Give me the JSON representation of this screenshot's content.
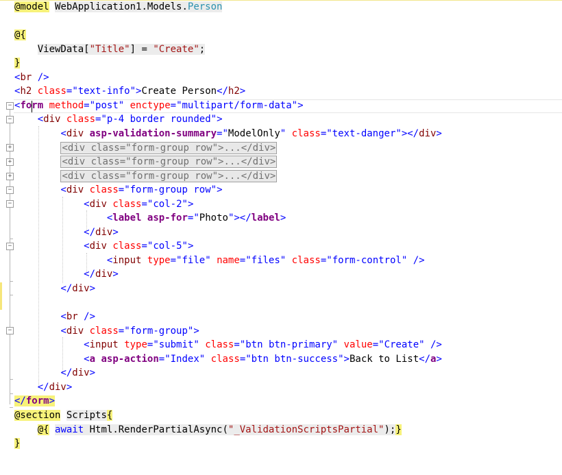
{
  "editor": {
    "colors": {
      "razor_highlight": "#f7f27a",
      "tag": "#0000ff",
      "element": "#800000",
      "attribute": "#ff0000",
      "value": "#0000ff",
      "tag_helper": "#800080"
    },
    "lines": [
      {
        "tokens": [
          {
            "t": "@model",
            "c": "hl"
          },
          {
            "t": " "
          },
          {
            "t": "WebApplication1.Models.",
            "c": "dim"
          },
          {
            "t": "Person",
            "c": "teal dim"
          }
        ]
      },
      {
        "tokens": []
      },
      {
        "tokens": [
          {
            "t": "@{",
            "c": "hl"
          }
        ]
      },
      {
        "tokens": [
          {
            "t": "    "
          },
          {
            "t": "ViewData[",
            "c": "dim"
          },
          {
            "t": "\"Title\"",
            "c": "str dim"
          },
          {
            "t": "] = ",
            "c": "dim"
          },
          {
            "t": "\"Create\"",
            "c": "str dim"
          },
          {
            "t": ";",
            "c": "dim"
          }
        ]
      },
      {
        "tokens": [
          {
            "t": "}",
            "c": "hl"
          }
        ]
      },
      {
        "tokens": [
          {
            "t": "<",
            "c": "blue"
          },
          {
            "t": "br",
            "c": "maroon"
          },
          {
            "t": " />",
            "c": "blue"
          }
        ]
      },
      {
        "tokens": [
          {
            "t": "<",
            "c": "blue"
          },
          {
            "t": "h2",
            "c": "maroon"
          },
          {
            "t": " "
          },
          {
            "t": "class",
            "c": "red"
          },
          {
            "t": "=",
            "c": "blue"
          },
          {
            "t": "\"text-info\"",
            "c": "blue"
          },
          {
            "t": ">",
            "c": "blue"
          },
          {
            "t": "Create Person"
          },
          {
            "t": "</",
            "c": "blue"
          },
          {
            "t": "h2",
            "c": "maroon"
          },
          {
            "t": ">",
            "c": "blue"
          }
        ]
      },
      {
        "tokens": [
          {
            "t": "<",
            "c": "blue"
          },
          {
            "t": "form",
            "c": "purple bold"
          },
          {
            "t": " "
          },
          {
            "t": "method",
            "c": "red"
          },
          {
            "t": "=",
            "c": "blue"
          },
          {
            "t": "\"post\"",
            "c": "blue"
          },
          {
            "t": " "
          },
          {
            "t": "enctype",
            "c": "red"
          },
          {
            "t": "=",
            "c": "blue"
          },
          {
            "t": "\"multipart/form-data\"",
            "c": "blue"
          },
          {
            "t": ">",
            "c": "blue"
          }
        ]
      },
      {
        "tokens": [
          {
            "t": "    "
          },
          {
            "t": "<",
            "c": "blue"
          },
          {
            "t": "div",
            "c": "maroon"
          },
          {
            "t": " "
          },
          {
            "t": "class",
            "c": "red"
          },
          {
            "t": "=",
            "c": "blue"
          },
          {
            "t": "\"p-4 border rounded\"",
            "c": "blue"
          },
          {
            "t": ">",
            "c": "blue"
          }
        ]
      },
      {
        "tokens": [
          {
            "t": "        "
          },
          {
            "t": "<",
            "c": "blue"
          },
          {
            "t": "div",
            "c": "maroon"
          },
          {
            "t": " "
          },
          {
            "t": "asp-validation-summary",
            "c": "purple bold"
          },
          {
            "t": "=",
            "c": "blue"
          },
          {
            "t": "\"",
            "c": "blue"
          },
          {
            "t": "ModelOnly"
          },
          {
            "t": "\"",
            "c": "blue"
          },
          {
            "t": " "
          },
          {
            "t": "class",
            "c": "red"
          },
          {
            "t": "=",
            "c": "blue"
          },
          {
            "t": "\"text-danger\"",
            "c": "blue"
          },
          {
            "t": "></",
            "c": "blue"
          },
          {
            "t": "div",
            "c": "maroon"
          },
          {
            "t": ">",
            "c": "blue"
          }
        ]
      },
      {
        "tokens": [
          {
            "t": "        "
          },
          {
            "t": "<div class=\"form-group row\">...</div>",
            "c": "collapsed"
          }
        ]
      },
      {
        "tokens": [
          {
            "t": "        "
          },
          {
            "t": "<div class=\"form-group row\">...</div>",
            "c": "collapsed"
          }
        ]
      },
      {
        "tokens": [
          {
            "t": "        "
          },
          {
            "t": "<div class=\"form-group row\">...</div>",
            "c": "collapsed"
          }
        ]
      },
      {
        "tokens": [
          {
            "t": "        "
          },
          {
            "t": "<",
            "c": "blue"
          },
          {
            "t": "div",
            "c": "maroon"
          },
          {
            "t": " "
          },
          {
            "t": "class",
            "c": "red"
          },
          {
            "t": "=",
            "c": "blue"
          },
          {
            "t": "\"form-group row\"",
            "c": "blue"
          },
          {
            "t": ">",
            "c": "blue"
          }
        ]
      },
      {
        "tokens": [
          {
            "t": "            "
          },
          {
            "t": "<",
            "c": "blue"
          },
          {
            "t": "div",
            "c": "maroon"
          },
          {
            "t": " "
          },
          {
            "t": "class",
            "c": "red"
          },
          {
            "t": "=",
            "c": "blue"
          },
          {
            "t": "\"col-2\"",
            "c": "blue"
          },
          {
            "t": ">",
            "c": "blue"
          }
        ]
      },
      {
        "tokens": [
          {
            "t": "                "
          },
          {
            "t": "<",
            "c": "blue"
          },
          {
            "t": "label",
            "c": "purple bold"
          },
          {
            "t": " "
          },
          {
            "t": "asp-for",
            "c": "purple bold"
          },
          {
            "t": "=",
            "c": "blue"
          },
          {
            "t": "\"",
            "c": "blue"
          },
          {
            "t": "Photo"
          },
          {
            "t": "\"",
            "c": "blue"
          },
          {
            "t": "></",
            "c": "blue"
          },
          {
            "t": "label",
            "c": "purple bold"
          },
          {
            "t": ">",
            "c": "blue"
          }
        ]
      },
      {
        "tokens": [
          {
            "t": "            "
          },
          {
            "t": "</",
            "c": "blue"
          },
          {
            "t": "div",
            "c": "maroon"
          },
          {
            "t": ">",
            "c": "blue"
          }
        ]
      },
      {
        "tokens": [
          {
            "t": "            "
          },
          {
            "t": "<",
            "c": "blue"
          },
          {
            "t": "div",
            "c": "maroon"
          },
          {
            "t": " "
          },
          {
            "t": "class",
            "c": "red"
          },
          {
            "t": "=",
            "c": "blue"
          },
          {
            "t": "\"col-5\"",
            "c": "blue"
          },
          {
            "t": ">",
            "c": "blue"
          }
        ]
      },
      {
        "tokens": [
          {
            "t": "                "
          },
          {
            "t": "<",
            "c": "blue"
          },
          {
            "t": "input",
            "c": "maroon"
          },
          {
            "t": " "
          },
          {
            "t": "type",
            "c": "red"
          },
          {
            "t": "=",
            "c": "blue"
          },
          {
            "t": "\"file\"",
            "c": "blue"
          },
          {
            "t": " "
          },
          {
            "t": "name",
            "c": "red"
          },
          {
            "t": "=",
            "c": "blue"
          },
          {
            "t": "\"files\"",
            "c": "blue"
          },
          {
            "t": " "
          },
          {
            "t": "class",
            "c": "red"
          },
          {
            "t": "=",
            "c": "blue"
          },
          {
            "t": "\"form-control\"",
            "c": "blue"
          },
          {
            "t": " />",
            "c": "blue"
          }
        ]
      },
      {
        "tokens": [
          {
            "t": "            "
          },
          {
            "t": "</",
            "c": "blue"
          },
          {
            "t": "div",
            "c": "maroon"
          },
          {
            "t": ">",
            "c": "blue"
          }
        ]
      },
      {
        "tokens": [
          {
            "t": "        "
          },
          {
            "t": "</",
            "c": "blue"
          },
          {
            "t": "div",
            "c": "maroon"
          },
          {
            "t": ">",
            "c": "blue"
          }
        ]
      },
      {
        "tokens": []
      },
      {
        "tokens": [
          {
            "t": "        "
          },
          {
            "t": "<",
            "c": "blue"
          },
          {
            "t": "br",
            "c": "maroon"
          },
          {
            "t": " />",
            "c": "blue"
          }
        ]
      },
      {
        "tokens": [
          {
            "t": "        "
          },
          {
            "t": "<",
            "c": "blue"
          },
          {
            "t": "div",
            "c": "maroon"
          },
          {
            "t": " "
          },
          {
            "t": "class",
            "c": "red"
          },
          {
            "t": "=",
            "c": "blue"
          },
          {
            "t": "\"form-group\"",
            "c": "blue"
          },
          {
            "t": ">",
            "c": "blue"
          }
        ]
      },
      {
        "tokens": [
          {
            "t": "            "
          },
          {
            "t": "<",
            "c": "blue"
          },
          {
            "t": "input",
            "c": "maroon"
          },
          {
            "t": " "
          },
          {
            "t": "type",
            "c": "red"
          },
          {
            "t": "=",
            "c": "blue"
          },
          {
            "t": "\"submit\"",
            "c": "blue"
          },
          {
            "t": " "
          },
          {
            "t": "class",
            "c": "red"
          },
          {
            "t": "=",
            "c": "blue"
          },
          {
            "t": "\"btn btn-primary\"",
            "c": "blue"
          },
          {
            "t": " "
          },
          {
            "t": "value",
            "c": "red"
          },
          {
            "t": "=",
            "c": "blue"
          },
          {
            "t": "\"Create\"",
            "c": "blue"
          },
          {
            "t": " />",
            "c": "blue"
          }
        ]
      },
      {
        "tokens": [
          {
            "t": "            "
          },
          {
            "t": "<",
            "c": "blue"
          },
          {
            "t": "a",
            "c": "purple bold"
          },
          {
            "t": " "
          },
          {
            "t": "asp-action",
            "c": "purple bold"
          },
          {
            "t": "=",
            "c": "blue"
          },
          {
            "t": "\"Index\"",
            "c": "blue"
          },
          {
            "t": " "
          },
          {
            "t": "class",
            "c": "red"
          },
          {
            "t": "=",
            "c": "blue"
          },
          {
            "t": "\"btn btn-success\"",
            "c": "blue"
          },
          {
            "t": ">",
            "c": "blue"
          },
          {
            "t": "Back to List"
          },
          {
            "t": "</",
            "c": "blue"
          },
          {
            "t": "a",
            "c": "purple bold"
          },
          {
            "t": ">",
            "c": "blue"
          }
        ]
      },
      {
        "tokens": [
          {
            "t": "        "
          },
          {
            "t": "</",
            "c": "blue"
          },
          {
            "t": "div",
            "c": "maroon"
          },
          {
            "t": ">",
            "c": "blue"
          }
        ]
      },
      {
        "tokens": [
          {
            "t": "    "
          },
          {
            "t": "</",
            "c": "blue"
          },
          {
            "t": "div",
            "c": "maroon"
          },
          {
            "t": ">",
            "c": "blue"
          }
        ]
      },
      {
        "tokens": [
          {
            "t": "</",
            "c": "blue hl"
          },
          {
            "t": "form",
            "c": "purple bold hl"
          },
          {
            "t": ">",
            "c": "blue hl"
          }
        ]
      },
      {
        "tokens": [
          {
            "t": "@section",
            "c": "hl"
          },
          {
            "t": " "
          },
          {
            "t": "Scripts",
            "c": "dim"
          },
          {
            "t": "{",
            "c": "hl"
          }
        ]
      },
      {
        "tokens": [
          {
            "t": "    "
          },
          {
            "t": "@{",
            "c": "hl"
          },
          {
            "t": " "
          },
          {
            "t": "await",
            "c": "blue dim"
          },
          {
            "t": " Html.RenderPartialAsync(",
            "c": "dim"
          },
          {
            "t": "\"_ValidationScriptsPartial\"",
            "c": "str dim"
          },
          {
            "t": ");",
            "c": "dim"
          },
          {
            "t": "}",
            "c": "hl"
          }
        ]
      },
      {
        "tokens": [
          {
            "t": "}",
            "c": "hl"
          }
        ]
      }
    ]
  }
}
